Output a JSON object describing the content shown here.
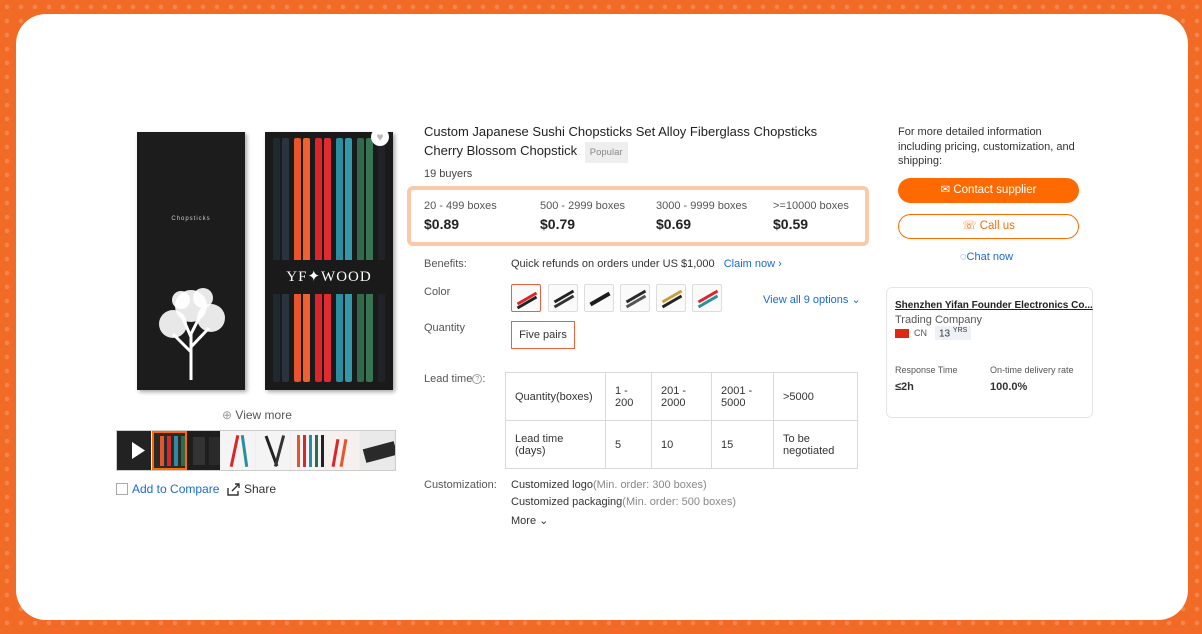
{
  "gallery": {
    "box_label": "Chopsticks",
    "brand": "YF✦WOOD",
    "view_more": "View more",
    "add_to_compare": "Add to Compare",
    "share": "Share"
  },
  "product": {
    "title": "Custom Japanese Sushi Chopsticks Set Alloy Fiberglass Chopsticks Cherry Blossom Chopstick",
    "badge": "Popular",
    "buyers": "19 buyers"
  },
  "price_tiers": [
    {
      "range": "20 - 499 boxes",
      "price": "$0.89"
    },
    {
      "range": "500 - 2999 boxes",
      "price": "$0.79"
    },
    {
      "range": "3000 - 9999 boxes",
      "price": "$0.69"
    },
    {
      "range": ">=10000 boxes",
      "price": "$0.59"
    }
  ],
  "benefits": {
    "label": "Benefits:",
    "text": "Quick refunds on orders under US $1,000",
    "link": "Claim now ›"
  },
  "color": {
    "label": "Color",
    "view_all": "View all 9 options ⌄"
  },
  "quantity": {
    "label": "Quantity",
    "option": "Five pairs"
  },
  "lead_time": {
    "label": "Lead time",
    "header": [
      "Quantity(boxes)",
      "1 - 200",
      "201 - 2000",
      "2001 - 5000",
      ">5000"
    ],
    "row": [
      "Lead time (days)",
      "5",
      "10",
      "15",
      "To be negotiated"
    ]
  },
  "customization": {
    "label": "Customization:",
    "items": [
      {
        "name": "Customized logo",
        "min": "(Min. order: 300 boxes)"
      },
      {
        "name": "Customized packaging",
        "min": "(Min. order: 500 boxes)"
      }
    ],
    "more": "More ⌄"
  },
  "contact": {
    "info": "For more detailed information including pricing, customization, and shipping:",
    "contact_supplier": "Contact supplier",
    "call_us": "Call us",
    "chat_now": "Chat now"
  },
  "supplier": {
    "name": "Shenzhen Yifan Founder Electronics Co...",
    "type": "Trading Company",
    "country": "CN",
    "years": "13",
    "years_unit": "YRS",
    "response_time_label": "Response Time",
    "response_time": "≤2h",
    "ontime_label": "On-time delivery rate",
    "ontime": "100.0%"
  },
  "colors": {
    "accent": "#ff6a00",
    "link": "#1a6ad4",
    "background": "#f26b26"
  }
}
